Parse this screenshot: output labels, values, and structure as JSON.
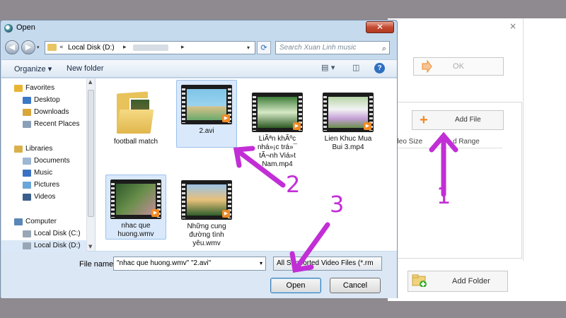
{
  "window": {
    "title": "Open",
    "close_glyph": "✕"
  },
  "address": {
    "crumb_start": "«",
    "crumb1": "Local Disk (D:)",
    "crumb_sep": "▸",
    "crumb_end": "▸",
    "dropdown": "▾"
  },
  "search": {
    "placeholder": "Search Xuan Linh music",
    "icon": "search-icon"
  },
  "toolbar": {
    "organize": "Organize ▾",
    "new_folder": "New folder"
  },
  "nav": {
    "items": [
      {
        "label": "Favorites",
        "icon": "star-icon",
        "color": "#e9b432"
      },
      {
        "label": "Desktop",
        "icon": "desktop-icon",
        "color": "#3b78c8"
      },
      {
        "label": "Downloads",
        "icon": "downloads-icon",
        "color": "#d9a63a"
      },
      {
        "label": "Recent Places",
        "icon": "recent-places-icon",
        "color": "#8aa0b8"
      },
      {
        "label": "Libraries",
        "icon": "libraries-icon",
        "color": "#d9b04a"
      },
      {
        "label": "Documents",
        "icon": "documents-icon",
        "color": "#9cb6d4"
      },
      {
        "label": "Music",
        "icon": "music-icon",
        "color": "#3a71c4"
      },
      {
        "label": "Pictures",
        "icon": "pictures-icon",
        "color": "#6aa6d9"
      },
      {
        "label": "Videos",
        "icon": "videos-icon",
        "color": "#3b5f8c"
      },
      {
        "label": "Computer",
        "icon": "computer-icon",
        "color": "#5a87b8"
      },
      {
        "label": "Local Disk (C:)",
        "icon": "drive-icon",
        "color": "#98a7b6"
      },
      {
        "label": "Local Disk (D:)",
        "icon": "drive-icon",
        "color": "#98a7b6"
      }
    ]
  },
  "files": [
    {
      "name": "football match",
      "kind": "folder"
    },
    {
      "name": "2.avi",
      "kind": "video",
      "selected": true
    },
    {
      "name": "LiÃªn khÃºc nhá»¡c trá»¯ tÃ¬nh Viá»t Nam.mp4",
      "kind": "video"
    },
    {
      "name": "Lien Khuc Mua Bui 3.mp4",
      "kind": "video"
    },
    {
      "name": "nhac que huong.wmv",
      "kind": "video",
      "selected": true
    },
    {
      "name": "Những cung đường tình yêu.wmv",
      "kind": "video"
    }
  ],
  "bottom": {
    "file_name_label": "File name:",
    "file_name_value": "\"nhac que huong.wmv\" \"2.avi\"",
    "filter_value": "All Supported Video Files (*.rm",
    "open_label": "Open",
    "cancel_label": "Cancel"
  },
  "background_app": {
    "ok_label": "OK",
    "add_file_label": "Add File",
    "col_video_size": "ideo Size",
    "col_range": "d Range",
    "add_folder_label": "Add Folder",
    "close_glyph": "×"
  },
  "annotations": {
    "step1": "1",
    "step2": "2",
    "step3": "3",
    "color": "#c22ed6"
  }
}
